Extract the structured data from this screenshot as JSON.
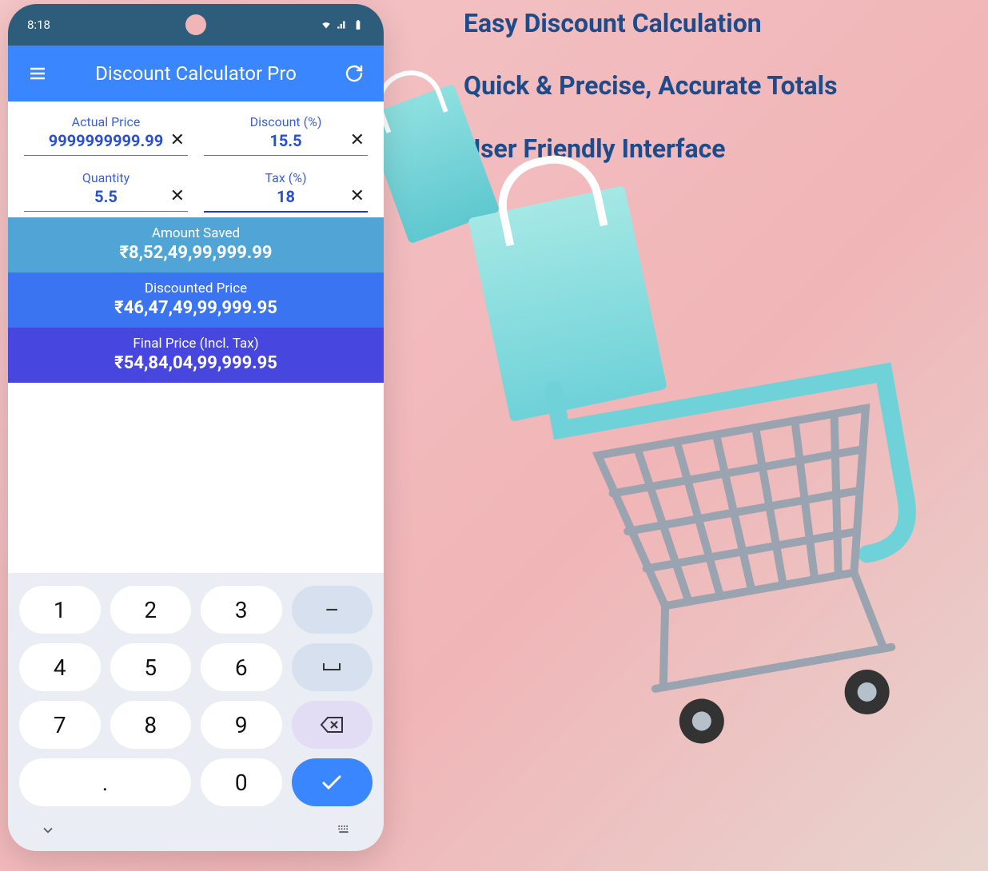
{
  "status_bar": {
    "time": "8:18"
  },
  "app_bar": {
    "title": "Discount Calculator Pro"
  },
  "inputs": {
    "actual_price": {
      "label": "Actual Price",
      "value": "9999999999.99"
    },
    "discount": {
      "label": "Discount (%)",
      "value": "15.5"
    },
    "quantity": {
      "label": "Quantity",
      "value": "5.5"
    },
    "tax": {
      "label": "Tax (%)",
      "value": "18"
    }
  },
  "results": {
    "saved": {
      "label": "Amount Saved",
      "value": "₹8,52,49,99,999.99"
    },
    "disc": {
      "label": "Discounted Price",
      "value": "₹46,47,49,99,999.95"
    },
    "final": {
      "label": "Final Price (Incl. Tax)",
      "value": "₹54,84,04,99,999.95"
    }
  },
  "keypad": {
    "k1": "1",
    "k2": "2",
    "k3": "3",
    "minus": "–",
    "k4": "4",
    "k5": "5",
    "k6": "6",
    "space": "␣",
    "k7": "7",
    "k8": "8",
    "k9": "9",
    "dot": ".",
    "k0": "0"
  },
  "marketing": {
    "line1": "Easy Discount Calculation",
    "line2": "Quick & Precise, Accurate Totals",
    "line3": "User Friendly Interface"
  }
}
